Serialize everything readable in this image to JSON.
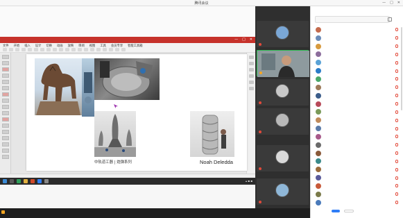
{
  "window": {
    "title": "腾讯会议",
    "controls": [
      "—",
      "□",
      "✕"
    ]
  },
  "ppt": {
    "tabs_label": "",
    "doc_title": "",
    "menus": [
      "文件",
      "开始",
      "插入",
      "设计",
      "切换",
      "动画",
      "放映",
      "审阅",
      "视图",
      "工具",
      "会员专享",
      "智能工具箱"
    ],
    "status_left": "",
    "status_right": ""
  },
  "slide": {
    "caption_horse": "",
    "caption_rockets": "中轨道工器 | 炮弹系列",
    "caption_noah": "Noah Deledda",
    "body_text": ""
  },
  "videos": {
    "tiles": [
      {
        "name": "",
        "active": false
      },
      {
        "name": "",
        "active": true
      },
      {
        "name": "",
        "active": false
      },
      {
        "name": "",
        "active": false
      },
      {
        "name": "",
        "active": false
      },
      {
        "name": "",
        "active": false
      }
    ]
  },
  "panel": {
    "title": "",
    "search_placeholder": "",
    "participants": [
      {
        "name": "",
        "color": "#c46b4d"
      },
      {
        "name": "",
        "color": "#6a8bb8"
      },
      {
        "name": "",
        "color": "#d79a3f"
      },
      {
        "name": "",
        "color": "#8c6d9c"
      },
      {
        "name": "",
        "color": "#5aa2d6"
      },
      {
        "name": "",
        "color": "#2a7cc8"
      },
      {
        "name": "",
        "color": "#4aa86a"
      },
      {
        "name": "",
        "color": "#9c7a5a"
      },
      {
        "name": "",
        "color": "#3b5d8a"
      },
      {
        "name": "",
        "color": "#b84a5a"
      },
      {
        "name": "",
        "color": "#7a9a5a"
      },
      {
        "name": "",
        "color": "#c08a5a"
      },
      {
        "name": "",
        "color": "#5a7aa8"
      },
      {
        "name": "",
        "color": "#a85a8a"
      },
      {
        "name": "",
        "color": "#6a6a6a"
      },
      {
        "name": "",
        "color": "#8a5a3a"
      },
      {
        "name": "",
        "color": "#3a8a8a"
      },
      {
        "name": "",
        "color": "#9a6a3a"
      },
      {
        "name": "",
        "color": "#5a5a9a"
      },
      {
        "name": "",
        "color": "#c85a3a"
      },
      {
        "name": "",
        "color": "#7a7a4a"
      },
      {
        "name": "",
        "color": "#4a7aba"
      }
    ],
    "btn_primary": "",
    "btn_plain": ""
  },
  "bottombar": {
    "sharer": ""
  }
}
